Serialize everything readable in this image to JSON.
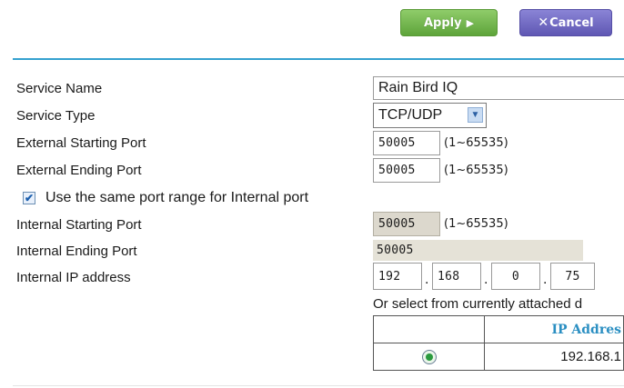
{
  "toolbar": {
    "apply_label": "Apply",
    "cancel_label": "Cancel"
  },
  "form": {
    "service_name": {
      "label": "Service Name",
      "value": "Rain Bird IQ"
    },
    "service_type": {
      "label": "Service Type",
      "value": "TCP/UDP"
    },
    "external_starting_port": {
      "label": "External Starting Port",
      "value": "50005",
      "range": "(1~65535)"
    },
    "external_ending_port": {
      "label": "External Ending Port",
      "value": "50005",
      "range": "(1~65535)"
    },
    "same_range": {
      "label": "Use the same port range for Internal port",
      "checked": true
    },
    "internal_starting_port": {
      "label": "Internal Starting Port",
      "value": "50005",
      "range": "(1~65535)"
    },
    "internal_ending_port": {
      "label": "Internal Ending Port",
      "value": "50005"
    },
    "internal_ip": {
      "label": "Internal IP address",
      "octets": [
        "192",
        "168",
        "0",
        "75"
      ]
    },
    "select_hint": "Or select from currently attached d"
  },
  "device_table": {
    "header": "IP Addres",
    "rows": [
      {
        "ip": "192.168.1",
        "selected": true
      }
    ]
  },
  "colors": {
    "apply": "#6db447",
    "cancel": "#6e67c4",
    "divider": "#35a1cf",
    "header_text": "#2b8fc2"
  }
}
